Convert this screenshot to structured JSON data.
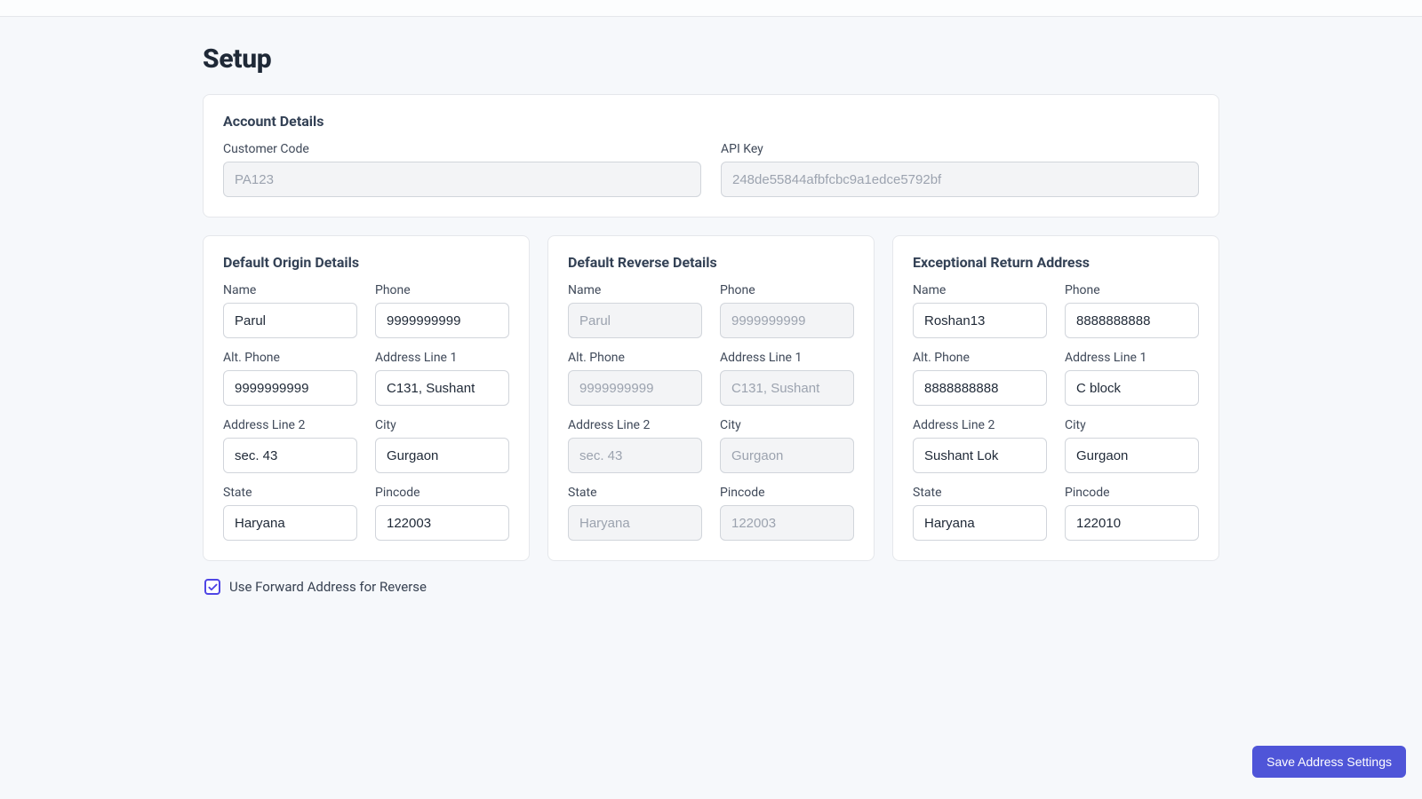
{
  "page": {
    "title": "Setup"
  },
  "account": {
    "section_title": "Account Details",
    "customer_code_label": "Customer Code",
    "customer_code_value": "PA123",
    "api_key_label": "API Key",
    "api_key_value": "248de55844afbfcbc9a1edce5792bf"
  },
  "labels": {
    "name": "Name",
    "phone": "Phone",
    "alt_phone": "Alt. Phone",
    "addr1": "Address Line 1",
    "addr2": "Address Line 2",
    "city": "City",
    "state": "State",
    "pincode": "Pincode"
  },
  "origin": {
    "section_title": "Default Origin Details",
    "name": "Parul",
    "phone": "9999999999",
    "alt_phone": "9999999999",
    "addr1": "C131, Sushant",
    "addr2": "sec. 43",
    "city": "Gurgaon",
    "state": "Haryana",
    "pincode": "122003"
  },
  "reverse": {
    "section_title": "Default Reverse Details",
    "name": "Parul",
    "phone": "9999999999",
    "alt_phone": "9999999999",
    "addr1": "C131, Sushant",
    "addr2": "sec. 43",
    "city": "Gurgaon",
    "state": "Haryana",
    "pincode": "122003"
  },
  "exceptional": {
    "section_title": "Exceptional Return Address",
    "name": "Roshan13",
    "phone": "8888888888",
    "alt_phone": "8888888888",
    "addr1": "C block",
    "addr2": "Sushant Lok",
    "city": "Gurgaon",
    "state": "Haryana",
    "pincode": "122010"
  },
  "checkbox": {
    "label": "Use Forward Address for Reverse",
    "checked": true
  },
  "footer": {
    "save_label": "Save Address Settings"
  },
  "colors": {
    "primary": "#4f55d8",
    "checkbox_border": "#4f46e5",
    "page_bg": "#f6f8fb",
    "card_border": "#e5e7eb"
  }
}
